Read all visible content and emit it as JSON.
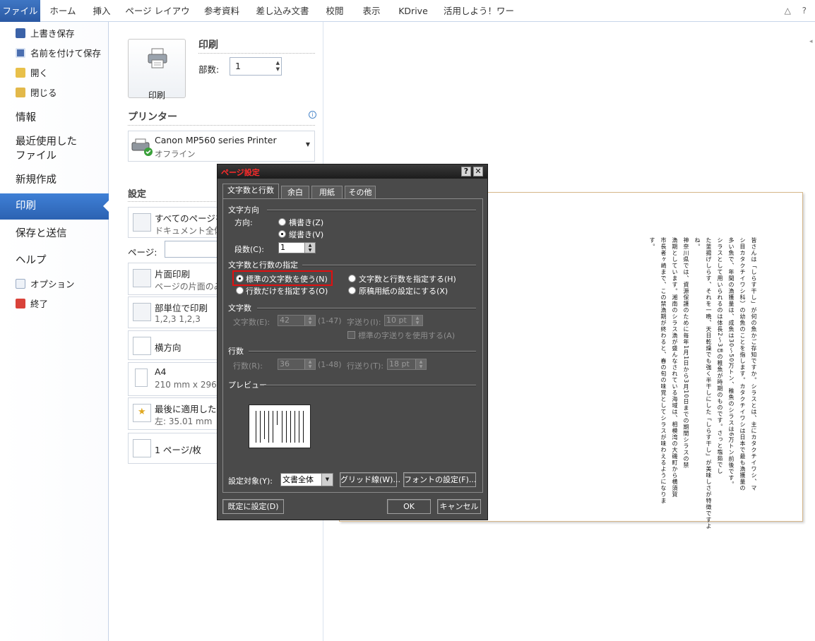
{
  "ribbon": {
    "tabs": [
      "ファイル",
      "ホーム",
      "挿入",
      "ページ レイアウト",
      "参考資料",
      "差し込み文書",
      "校閲",
      "表示",
      "KDrive",
      "活用しよう！ワード"
    ],
    "right_icons": "△ ?"
  },
  "leftnav": {
    "save": "上書き保存",
    "save_as": "名前を付けて保存",
    "open": "開く",
    "close": "閉じる",
    "info": "情報",
    "recent": "最近使用した\nファイル",
    "new": "新規作成",
    "print": "印刷",
    "save_send": "保存と送信",
    "help": "ヘルプ",
    "options": "オプション",
    "exit": "終了"
  },
  "print": {
    "title": "印刷",
    "button_label": "印刷",
    "copies_label": "部数:",
    "copies_value": "1",
    "printer_heading": "プリンター",
    "printer_name": "Canon MP560 series Printer",
    "printer_status": "オフライン",
    "settings_heading": "設定",
    "setting1_title": "すべてのページを印",
    "setting1_sub": "ドキュメント全体を",
    "pages_label": "ページ:",
    "setting2_title": "片面印刷",
    "setting2_sub": "ページの片面のみ",
    "setting3_title": "部単位で印刷",
    "setting3_sub": "1,2,3    1,2,3",
    "setting4_title": "横方向",
    "setting5_title": "A4",
    "setting5_sub": "210 mm x 296",
    "setting6_title": "最後に適用した余",
    "setting6_sub": "左:  35.01 mm",
    "setting7_title": "1 ページ/枚"
  },
  "preview": {
    "columns": [
      "皆さんは「しらす干し」が何の魚かご存知ですか。シラスとは、主にカタクチイワシ、マ",
      "シ目カタクチイワシ科）の幼魚のことを指します。カタクチイワシは日本で最も漁獲量の",
      "多い魚で、年間の漁獲量は、成魚は30～50万トン、稚魚のシラスは6万トン前後です。",
      "シラスとして用いられるのは体長2～3㎝の稚魚が時期のものです。さっと塩茹でし",
      "た釜揚げしらす、それを一晩、天日乾燥でも強く半干しにした「しらす干し」が美味しさが特徴ですよ",
      "ね。",
      "神奈川県では、資源保護のために毎年1月1日から3月10日までの期間シラスの禁",
      "漁期としています。湘南のシラス漁が盛んなされている海域は、相模湾の大磯町から横須賀",
      "市長者ヶ崎まで、この禁漁期が終わると、春の旬の味覚としてシラスが味わえるようになりま",
      "す。"
    ]
  },
  "dialog": {
    "title": "ページ設定",
    "tabs": [
      "文字数と行数",
      "余白",
      "用紙",
      "その他"
    ],
    "direction_group": "文字方向",
    "direction_label": "方向:",
    "horizontal": "横書き(Z)",
    "vertical": "縦書き(V)",
    "columns_label": "段数(C):",
    "columns_value": "1",
    "spec_group": "文字数と行数の指定",
    "opt_standard": "標準の文字数を使う(N)",
    "opt_chars_lines": "文字数と行数を指定する(H)",
    "opt_lines_only": "行数だけを指定する(O)",
    "opt_manuscript": "原稿用紙の設定にする(X)",
    "chars_group": "文字数",
    "chars_label": "文字数(E):",
    "chars_value": "42",
    "chars_range": "(1-47)",
    "char_pitch_label": "字送り(I):",
    "char_pitch_value": "10 pt",
    "use_std_pitch": "標準の字送りを使用する(A)",
    "lines_group": "行数",
    "lines_label": "行数(R):",
    "lines_value": "36",
    "lines_range": "(1-48)",
    "line_pitch_label": "行送り(T):",
    "line_pitch_value": "18 pt",
    "preview_group": "プレビュー",
    "apply_label": "設定対象(Y):",
    "apply_value": "文書全体",
    "grid_button": "グリッド線(W)...",
    "font_button": "フォントの設定(F)...",
    "default_button": "既定に設定(D)",
    "ok_button": "OK",
    "cancel_button": "キャンセル",
    "help_btn": "?",
    "close_btn": "✕"
  }
}
